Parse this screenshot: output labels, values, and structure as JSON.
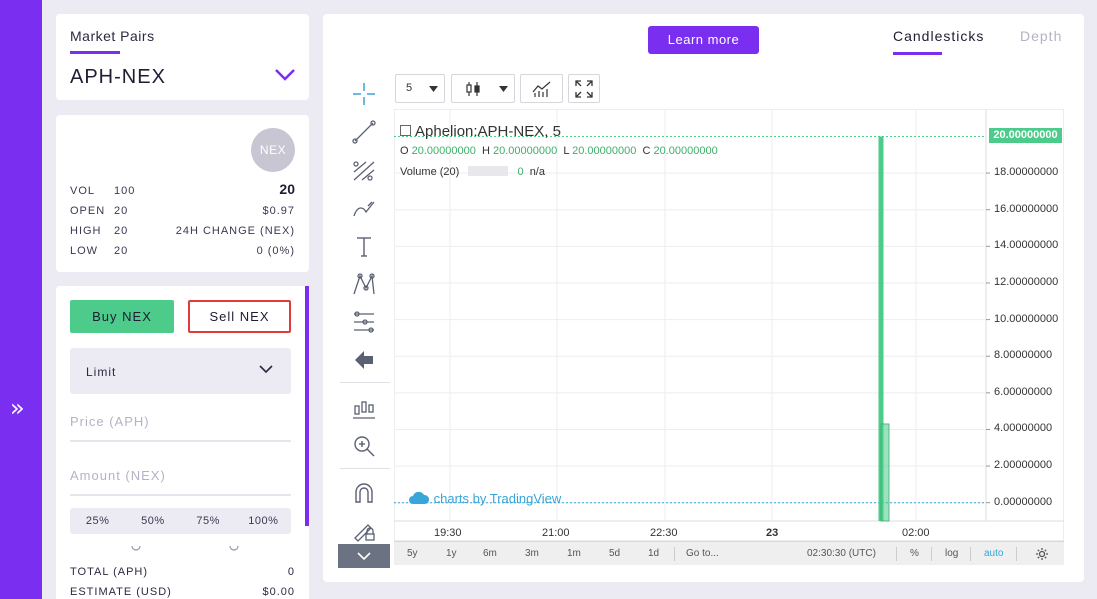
{
  "sidebar": {
    "expand_glyph": "»"
  },
  "market_pairs": {
    "label": "Market Pairs",
    "value": "APH-NEX"
  },
  "stats": {
    "coin_badge": "NEX",
    "price": "20",
    "rows": [
      {
        "label": "VOL",
        "value": "100",
        "right": ""
      },
      {
        "label": "OPEN",
        "value": "20",
        "right": "$0.97"
      },
      {
        "label": "HIGH",
        "value": "20",
        "right": "24H CHANGE (NEX)"
      },
      {
        "label": "LOW",
        "value": "20",
        "right": "0 (0%)"
      }
    ]
  },
  "order": {
    "buy_label": "Buy NEX",
    "sell_label": "Sell NEX",
    "order_type": "Limit",
    "price_placeholder": "Price (APH)",
    "amount_placeholder": "Amount (NEX)",
    "percentages": [
      "25%",
      "50%",
      "75%",
      "100%"
    ],
    "total_label": "TOTAL (APH)",
    "total_value": "0",
    "estimate_label": "ESTIMATE (USD)",
    "estimate_value": "$0.00"
  },
  "chart_header": {
    "learn_more": "Learn more",
    "tabs": [
      "Candlesticks",
      "Depth"
    ],
    "active_tab": "Candlesticks"
  },
  "toolbar": {
    "interval": "5"
  },
  "chart_data": {
    "type": "bar",
    "title": "Aphelion:APH-NEX, 5",
    "ohlc": {
      "o": "20.00000000",
      "h": "20.00000000",
      "l": "20.00000000",
      "c": "20.00000000"
    },
    "ohlc_labels": {
      "o": "O",
      "h": "H",
      "l": "L",
      "c": "C"
    },
    "volume_label": "Volume (20)",
    "volume_value": "0",
    "volume_extra": "n/a",
    "last_price_label": "20.00000000",
    "y_ticks": [
      "18.00000000",
      "16.00000000",
      "14.00000000",
      "12.00000000",
      "10.00000000",
      "8.00000000",
      "6.00000000",
      "4.00000000",
      "2.00000000",
      "0.00000000"
    ],
    "y_values": [
      18,
      16,
      14,
      12,
      10,
      8,
      6,
      4,
      2,
      0
    ],
    "ylim": [
      -1,
      21.5
    ],
    "x_ticks": [
      "19:30",
      "21:00",
      "22:30",
      "23",
      "02:00"
    ],
    "candle": {
      "time": "01:45",
      "open": 20,
      "high": 20,
      "low": 0,
      "close": 0
    },
    "volume_bar": {
      "time": "01:45",
      "value": 4.3
    },
    "last_price": 20,
    "grid": true,
    "watermark": "charts by TradingView",
    "accent_color": "#4ccb8a"
  },
  "range_bar": {
    "ranges": [
      "5y",
      "1y",
      "6m",
      "3m",
      "1m",
      "5d",
      "1d"
    ],
    "goto": "Go to...",
    "time": "02:30:30 (UTC)",
    "percent": "%",
    "log": "log",
    "auto": "auto"
  },
  "colors": {
    "accent": "#7a2ef0",
    "buy": "#4ccb8a",
    "sell": "#e33a3a"
  }
}
